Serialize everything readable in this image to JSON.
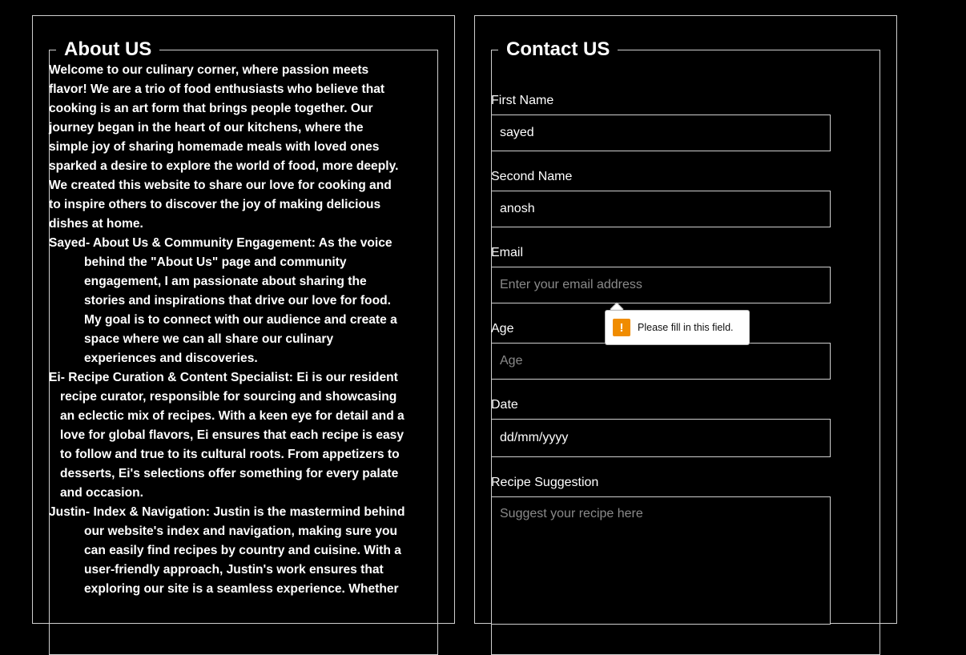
{
  "about": {
    "title": "About US",
    "intro": "Welcome to our culinary corner, where passion meets flavor! We are a trio of food enthusiasts who believe that cooking is an art form that brings people together. Our journey began in the heart of our kitchens, where the simple joy of sharing homemade meals with loved ones sparked a desire to explore the world of food, more deeply. We created this website to share our love for cooking and to inspire others to discover the joy of making delicious dishes at home.",
    "members": [
      {
        "name": "Sayed",
        "text": "- About Us & Community Engagement: As the voice behind the \"About Us\" page and community engagement, I am passionate about sharing the stories and inspirations that drive our love for food. My goal is to connect with our audience and create a space where we can all share our culinary experiences and discoveries."
      },
      {
        "name": "Ei",
        "text": "- Recipe Curation & Content Specialist: Ei is our resident recipe curator, responsible for sourcing and showcasing an eclectic mix of recipes. With a keen eye for detail and a love for global flavors, Ei ensures that each recipe is easy to follow and true to its cultural roots. From appetizers to desserts, Ei's selections offer something for every palate and occasion."
      },
      {
        "name": "Justin",
        "text": "- Index & Navigation: Justin is the mastermind behind our website's index and navigation, making sure you can easily find recipes by country and cuisine. With a user-friendly approach, Justin's work ensures that exploring our site is a seamless experience. Whether"
      }
    ]
  },
  "contact": {
    "title": "Contact US",
    "first_name": {
      "label": "First Name",
      "value": "sayed"
    },
    "second_name": {
      "label": "Second Name",
      "value": "anosh"
    },
    "email": {
      "label": "Email",
      "placeholder": "Enter your email address"
    },
    "age": {
      "label": "Age",
      "placeholder": "Age"
    },
    "date": {
      "label": "Date",
      "value": "dd/mm/yyyy"
    },
    "recipe": {
      "label": "Recipe Suggestion",
      "placeholder": "Suggest your recipe here"
    }
  },
  "validation": {
    "message": "Please fill in this field.",
    "icon": "warning-icon",
    "icon_color": "#f08c00"
  }
}
